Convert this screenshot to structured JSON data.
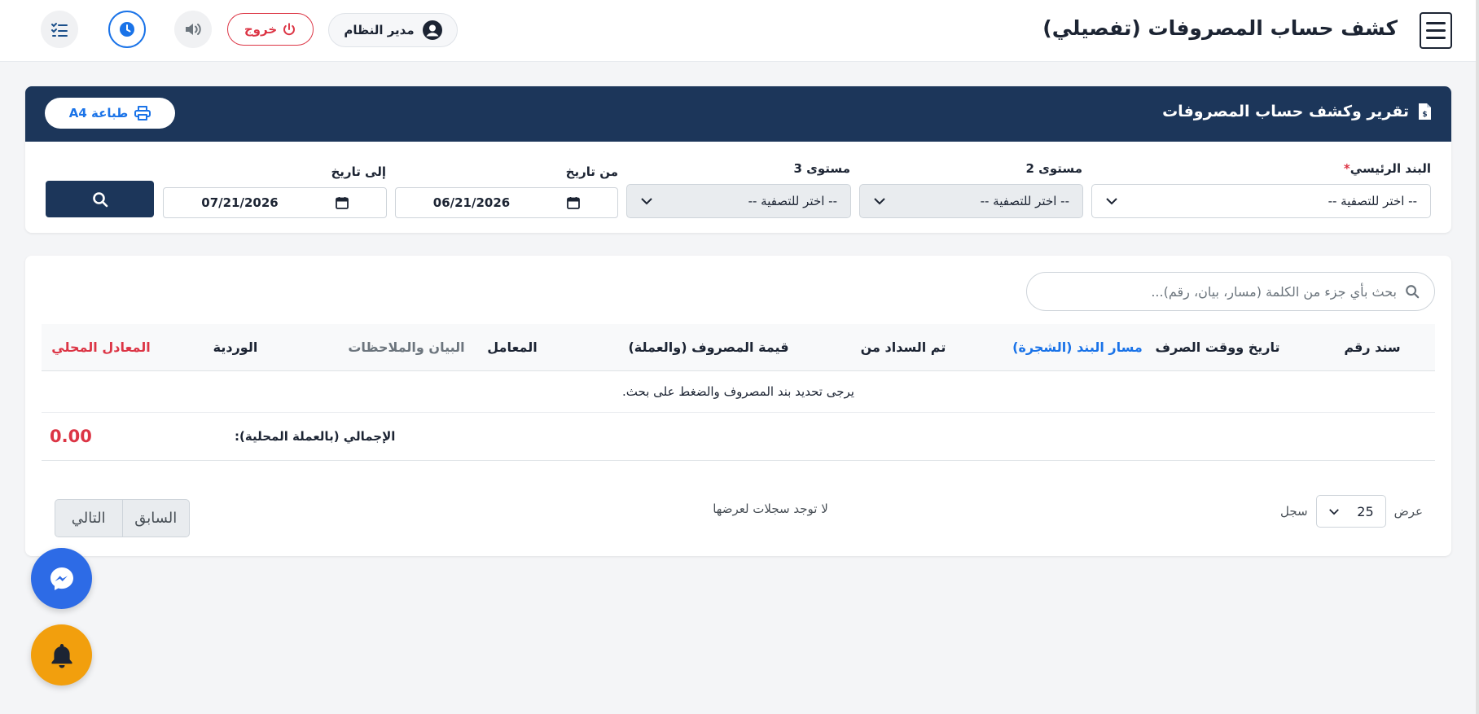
{
  "header": {
    "title": "كشف حساب المصروفات (تفصيلي)",
    "user_name": "مدير النظام",
    "logout_label": "خروج"
  },
  "report": {
    "title": "تقرير وكشف حساب المصروفات",
    "print_label": "طباعة A4",
    "filters": {
      "main_item": {
        "label": "البند الرئيسي",
        "required_mark": "*",
        "value": "-- اختر للتصفية --"
      },
      "level2": {
        "label": "مستوى 2",
        "value": "-- اختر للتصفية --"
      },
      "level3": {
        "label": "مستوى 3",
        "value": "-- اختر للتصفية --"
      },
      "from_date": {
        "label": "من تاريخ",
        "value": "06/21/2026"
      },
      "to_date": {
        "label": "إلى تاريخ",
        "value": "07/21/2026"
      }
    }
  },
  "table": {
    "search_placeholder": "بحث بأي جزء من الكلمة (مسار، بيان، رقم)...",
    "columns": [
      "سند رقم",
      "تاريخ ووقت الصرف",
      "مسار البند (الشجرة)",
      "تم السداد من",
      "قيمة المصروف (والعملة)",
      "المعامل",
      "البيان والملاحظات",
      "الوردية",
      "المعادل المحلي"
    ],
    "empty_message": "يرجى تحديد بند المصروف والضغط على بحث.",
    "total_label": "الإجمالي (بالعملة المحلية):",
    "total_value": "0.00"
  },
  "footer": {
    "show_label": "عرض",
    "page_size": "25",
    "records_label": "سجل",
    "no_records": "لا توجد سجلات لعرضها",
    "next_label": "التالي",
    "prev_label": "السابق"
  },
  "colors": {
    "navy": "#1c365a",
    "accent_blue": "#1a73e8",
    "danger": "#dc3545",
    "messenger": "#2d6be6",
    "bell": "#f29f0d"
  },
  "icons": [
    "menu-icon",
    "user-icon",
    "power-icon",
    "speaker-icon",
    "clock-icon",
    "tasks-icon",
    "invoice-icon",
    "printer-icon",
    "chevron-down-icon",
    "calendar-icon",
    "search-icon",
    "messenger-icon",
    "bell-icon"
  ]
}
